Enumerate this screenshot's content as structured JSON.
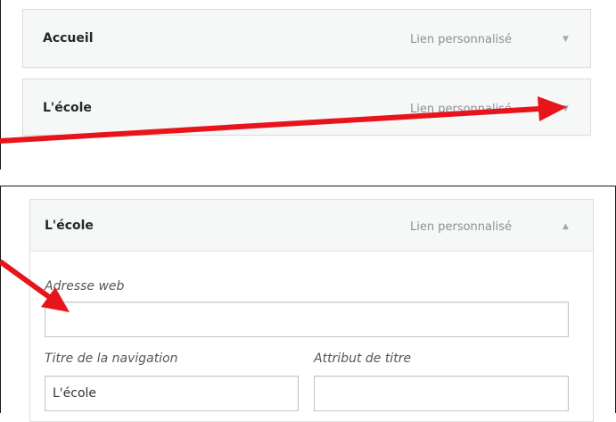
{
  "menu_items": [
    {
      "title": "Accueil",
      "type_label": "Lien personnalisé",
      "arrow": "▼"
    },
    {
      "title": "L'école",
      "type_label": "Lien personnalisé",
      "arrow": "▼"
    }
  ],
  "expanded_item": {
    "title": "L'école",
    "type_label": "Lien personnalisé",
    "arrow": "▲",
    "url_label": "Adresse web",
    "url_value": "",
    "nav_label_label": "Titre de la navigation",
    "nav_label_value": "L'école",
    "title_attr_label": "Attribut de titre",
    "title_attr_value": ""
  },
  "colors": {
    "annotation_arrow": "#e8141c",
    "item_header_bg": "#f6f7f7"
  },
  "icons": {
    "collapsed_toggle": "arrow-down-icon",
    "expanded_toggle": "arrow-up-icon"
  }
}
